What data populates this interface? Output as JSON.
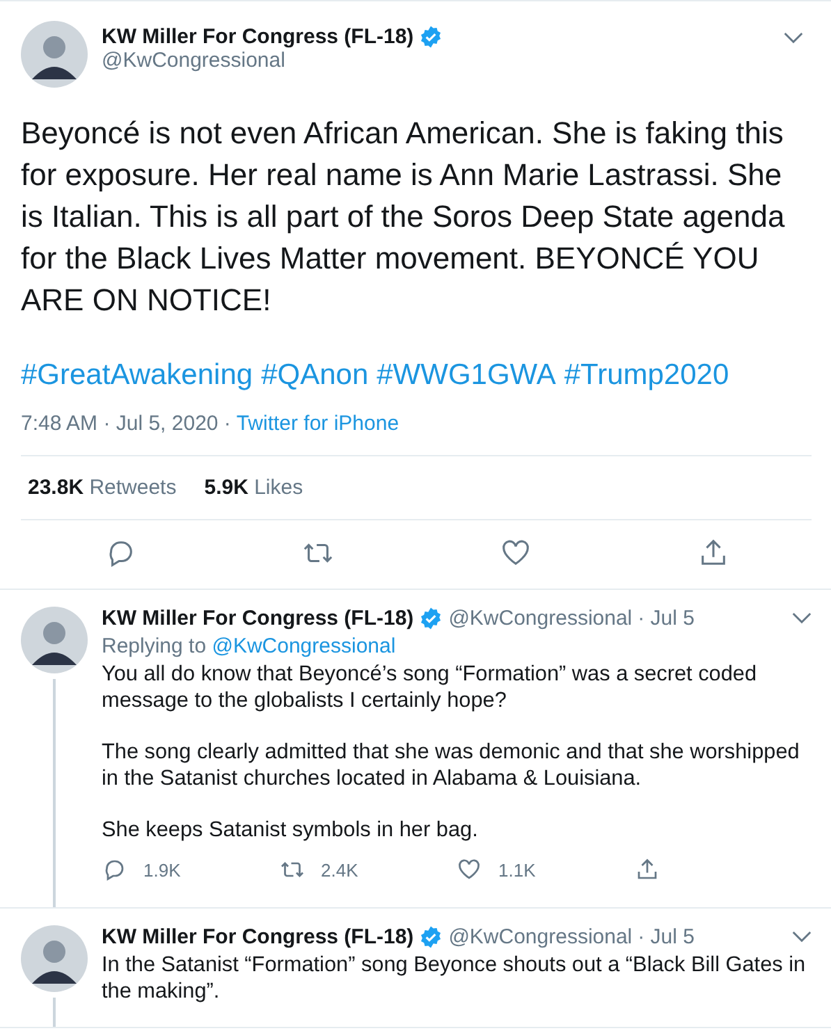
{
  "main_tweet": {
    "author": {
      "name": "KW Miller For Congress (FL-18)",
      "handle": "@KwCongressional",
      "verified": true
    },
    "text": "Beyoncé is not even African American. She is faking this for exposure. Her real name is Ann Marie Lastrassi. She is Italian. This is all part of the Soros Deep State agenda for the Black Lives Matter movement. BEYONCÉ YOU ARE ON NOTICE!",
    "hashtags": [
      "#GreatAwakening",
      "#QAnon",
      "#WWG1GWA",
      "#Trump2020"
    ],
    "time": "7:48 AM · Jul 5, 2020 · ",
    "source": "Twitter for iPhone",
    "stats": [
      {
        "count": "23.8K",
        "label": "Retweets"
      },
      {
        "count": "5.9K",
        "label": "Likes"
      }
    ]
  },
  "replies": [
    {
      "name": "KW Miller For Congress (FL-18)",
      "verified": true,
      "handle": "@KwCongressional",
      "date": "· Jul 5",
      "replying_to": {
        "prefix": "Replying to",
        "handle": "@KwCongressional"
      },
      "paragraphs": [
        "You all do know that Beyoncé’s song “Formation” was a secret coded message to the globalists I certainly hope?",
        "The song clearly admitted that she was demonic and that she worshipped in the Satanist churches located in Alabama & Louisiana.",
        "She keeps Satanist symbols in her bag."
      ],
      "counts": {
        "replies": "1.9K",
        "retweets": "2.4K",
        "likes": "1.1K"
      }
    },
    {
      "name": "KW Miller For Congress (FL-18)",
      "verified": true,
      "handle": "@KwCongressional",
      "date": "· Jul 5",
      "paragraphs": [
        "In the Satanist “Formation” song Beyonce shouts out a “Black Bill Gates in the making”."
      ]
    }
  ]
}
